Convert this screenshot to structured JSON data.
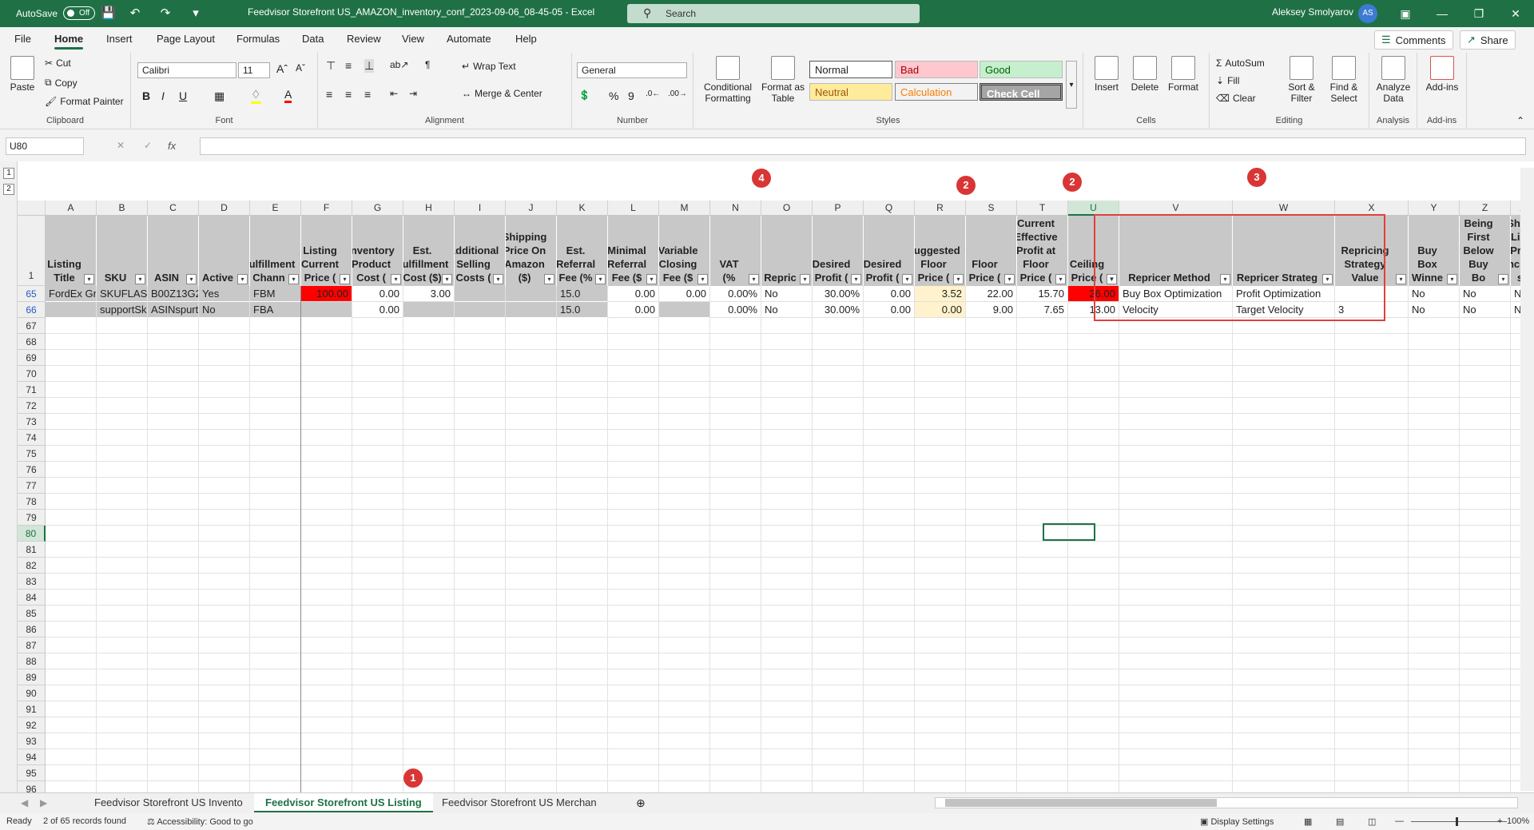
{
  "title_bar": {
    "autosave_label": "AutoSave",
    "autosave_state": "Off",
    "doc_title": "Feedvisor Storefront US_AMAZON_inventory_conf_2023-09-06_08-45-05  -  Excel",
    "search_placeholder": "Search",
    "user_name": "Aleksey Smolyarov",
    "user_initials": "AS"
  },
  "menu": {
    "items": [
      "File",
      "Home",
      "Insert",
      "Page Layout",
      "Formulas",
      "Data",
      "Review",
      "View",
      "Automate",
      "Help"
    ],
    "active": "Home",
    "comments_label": "Comments",
    "share_label": "Share"
  },
  "ribbon": {
    "clipboard": {
      "paste": "Paste",
      "cut": "Cut",
      "copy": "Copy",
      "format_painter": "Format Painter",
      "label": "Clipboard"
    },
    "font": {
      "name": "Calibri",
      "size": "11",
      "label": "Font",
      "bold": "B",
      "italic": "I",
      "underline": "U"
    },
    "alignment": {
      "wrap_text": "Wrap Text",
      "merge_center": "Merge & Center",
      "label": "Alignment"
    },
    "number": {
      "format": "General",
      "label": "Number"
    },
    "styles": {
      "conditional": "Conditional Formatting",
      "format_table": "Format as Table",
      "cells": [
        {
          "name": "Normal",
          "bg": "#ffffff",
          "fg": "#000000"
        },
        {
          "name": "Bad",
          "bg": "#ffc7ce",
          "fg": "#9c0006"
        },
        {
          "name": "Good",
          "bg": "#c6efce",
          "fg": "#006100"
        },
        {
          "name": "Neutral",
          "bg": "#ffeb9c",
          "fg": "#9c5700"
        },
        {
          "name": "Calculation",
          "bg": "#f2f2f2",
          "fg": "#fa7d00"
        },
        {
          "name": "Check Cell",
          "bg": "#a5a5a5",
          "fg": "#ffffff"
        }
      ],
      "label": "Styles"
    },
    "cells": {
      "insert": "Insert",
      "delete": "Delete",
      "format": "Format",
      "label": "Cells"
    },
    "editing": {
      "autosum": "AutoSum",
      "fill": "Fill",
      "clear": "Clear",
      "sort_filter": "Sort & Filter",
      "find_select": "Find & Select",
      "label": "Editing"
    },
    "analysis": {
      "analyze": "Analyze Data",
      "label": "Analysis"
    },
    "addins": {
      "addins": "Add-ins",
      "label": "Add-ins"
    }
  },
  "formula_bar": {
    "name_box": "U80",
    "fx": "fx",
    "formula": ""
  },
  "columns": [
    "A",
    "B",
    "C",
    "D",
    "E",
    "F",
    "G",
    "H",
    "I",
    "J",
    "K",
    "L",
    "M",
    "N",
    "O",
    "P",
    "Q",
    "R",
    "S",
    "T",
    "U",
    "V",
    "W",
    "X",
    "Y",
    "Z",
    "AA"
  ],
  "headers": {
    "A": "Listing Title",
    "B": "SKU",
    "C": "ASIN",
    "D": "Active",
    "E": "Fulfillment Chann",
    "F": "Listing Current Price (",
    "G": "Inventory Product Cost (",
    "H": "Est. Fulfillment Cost ($)",
    "I": "Additional Selling Costs (",
    "J": "Shipping Price On Amazon ($)",
    "K": "Est. Referral Fee (%",
    "L": "Minimal Referral Fee ($",
    "M": "Variable Closing Fee ($",
    "N": "VAT (%",
    "O": "Repric",
    "P": "Desired Profit (",
    "Q": "Desired Profit (",
    "R": "Suggested Floor Price (",
    "S": "Floor Price (",
    "T": "Current Effective Profit at Floor Price (",
    "U": "Ceiling Price (",
    "V": "Repricer Method",
    "W": "Repricer Strateg",
    "X": "Repricing Strategy Value",
    "Y": "Buy Box Winne",
    "Z": "Avoid Being First Below Buy Bo",
    "AA": "Shou Lim Pric Increa s"
  },
  "rows": [
    {
      "num": "65",
      "A": "FordEx Gr",
      "B": "SKUFLASH",
      "C": "B00Z13G2",
      "D": "Yes",
      "E": "FBM",
      "F": "100.00",
      "G": "0.00",
      "H": "3.00",
      "I": "",
      "J": "",
      "K": "15.0",
      "L": "0.00",
      "M": "0.00",
      "N": "0.00%",
      "O": "No",
      "P": "30.00%",
      "Q": "0.00",
      "R": "3.52",
      "S": "22.00",
      "T": "15.70",
      "U": "26.00",
      "V": "Buy Box Optimization",
      "W": "Profit Optimization",
      "X": "",
      "Y": "No",
      "Z": "No",
      "AA": "No"
    },
    {
      "num": "66",
      "A": "",
      "B": "supportSk",
      "C": "ASINspurt",
      "D": "No",
      "E": "FBA",
      "F": "",
      "G": "0.00",
      "H": "",
      "I": "",
      "J": "",
      "K": "15.0",
      "L": "0.00",
      "M": "",
      "N": "0.00%",
      "O": "No",
      "P": "30.00%",
      "Q": "0.00",
      "R": "0.00",
      "S": "9.00",
      "T": "7.65",
      "U": "13.00",
      "V": "Velocity",
      "W": "Target Velocity",
      "X": "3",
      "Y": "No",
      "Z": "No",
      "AA": "No"
    }
  ],
  "header_row_num": "1",
  "empty_rows": [
    "67",
    "68",
    "69",
    "70",
    "71",
    "72",
    "73",
    "74",
    "75",
    "76",
    "77",
    "78",
    "79",
    "80",
    "81",
    "82",
    "83",
    "84",
    "85",
    "86",
    "87",
    "88",
    "89",
    "90",
    "91",
    "92",
    "93",
    "94",
    "95",
    "96"
  ],
  "badges": {
    "b1": "1",
    "b2a": "2",
    "b2b": "2",
    "b3": "3",
    "b4": "4"
  },
  "outline_levels": [
    "1",
    "2"
  ],
  "sheet_tabs": [
    "Feedvisor Storefront US Invento",
    "Feedvisor Storefront US Listing",
    "Feedvisor Storefront US Merchan"
  ],
  "active_tab": "Feedvisor Storefront US Listing",
  "status": {
    "ready": "Ready",
    "records": "2 of 65 records found",
    "accessibility": "Accessibility: Good to go",
    "display_settings": "Display Settings",
    "zoom": "100%"
  }
}
